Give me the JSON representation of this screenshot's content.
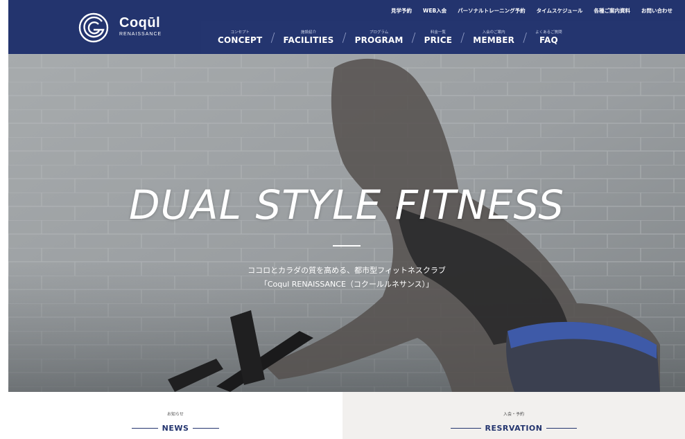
{
  "logo": {
    "name": "Coqūl",
    "sub": "RENAISSANCE"
  },
  "topnav": [
    "見学予約",
    "WEB入会",
    "パーソナルトレーニング予約",
    "タイムスケジュール",
    "各種ご案内資料",
    "お問い合わせ"
  ],
  "mainnav": [
    {
      "jp": "コンセプト",
      "en": "CONCEPT"
    },
    {
      "jp": "施設紹介",
      "en": "FACILITIES"
    },
    {
      "jp": "プログラム",
      "en": "PROGRAM"
    },
    {
      "jp": "料金一覧",
      "en": "PRICE"
    },
    {
      "jp": "入会のご案内",
      "en": "MEMBER"
    },
    {
      "jp": "よくあるご質問",
      "en": "FAQ"
    }
  ],
  "hero": {
    "title": "DUAL STYLE FITNESS",
    "line1": "ココロとカラダの質を高める、都市型フィットネスクラブ",
    "line2": "「Coqul RENAISSANCE（コクールルネサンス）」"
  },
  "panels": {
    "news": {
      "jp": "お知らせ",
      "en": "NEWS"
    },
    "reservation": {
      "jp": "入会・予約",
      "en": "RESRVATION"
    }
  },
  "colors": {
    "navy": "#23346e",
    "panel_right_bg": "#f2f0ee"
  }
}
